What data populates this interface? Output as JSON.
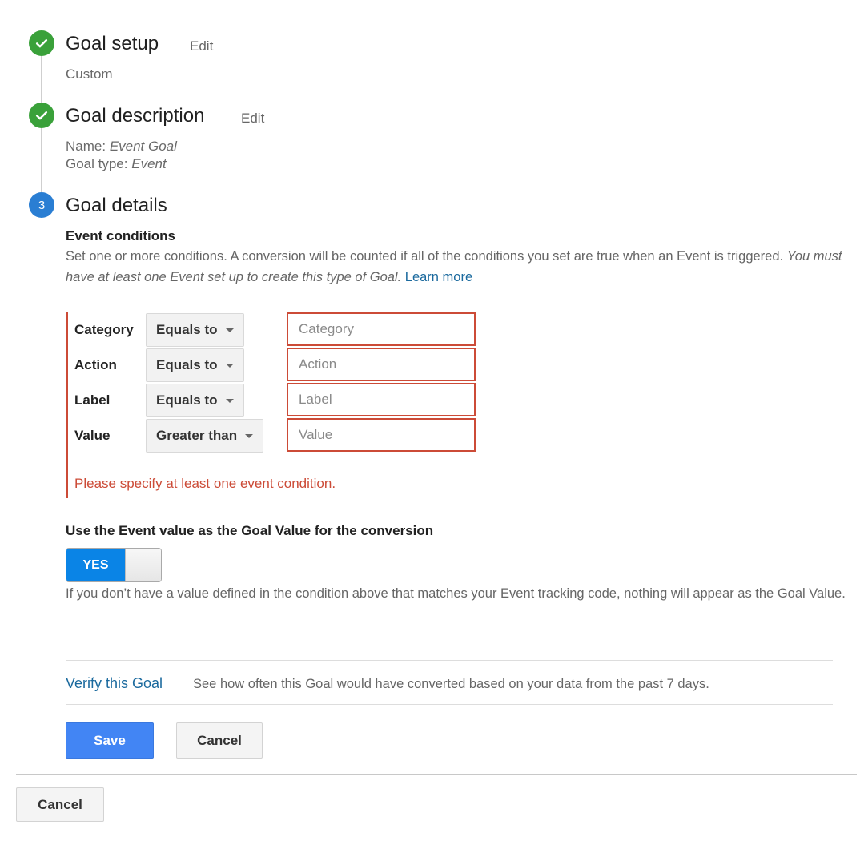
{
  "steps": [
    {
      "status": "done",
      "icon": "check-icon",
      "title": "Goal setup",
      "edit_label": "Edit",
      "summary": "Custom"
    },
    {
      "status": "done",
      "icon": "check-icon",
      "title": "Goal description",
      "edit_label": "Edit",
      "name_label": "Name:",
      "name_value": "Event Goal",
      "type_label": "Goal type:",
      "type_value": "Event"
    },
    {
      "status": "active",
      "number": "3",
      "title": "Goal details"
    }
  ],
  "event_conditions": {
    "title": "Event conditions",
    "description_plain": "Set one or more conditions. A conversion will be counted if all of the conditions you set are true when an Event is triggered.",
    "description_italic": "You must have at least one Event set up to create this type of Goal.",
    "learn_more": "Learn more",
    "rows": [
      {
        "label": "Category",
        "operator": "Equals to",
        "placeholder": "Category",
        "value": ""
      },
      {
        "label": "Action",
        "operator": "Equals to",
        "placeholder": "Action",
        "value": ""
      },
      {
        "label": "Label",
        "operator": "Equals to",
        "placeholder": "Label",
        "value": ""
      },
      {
        "label": "Value",
        "operator": "Greater than",
        "placeholder": "Value",
        "value": ""
      }
    ],
    "error": "Please specify at least one event condition.",
    "error_color": "#cc4b37"
  },
  "goal_value": {
    "title": "Use the Event value as the Goal Value for the conversion",
    "toggle_label": "YES",
    "toggle_on": true,
    "help": "If you don’t have a value defined in the condition above that matches your Event tracking code, nothing will appear as the Goal Value."
  },
  "verify": {
    "link": "Verify this Goal",
    "description": "See how often this Goal would have converted based on your data from the past 7 days."
  },
  "actions": {
    "save": "Save",
    "cancel": "Cancel"
  },
  "footer": {
    "cancel": "Cancel"
  },
  "colors": {
    "done": "#3aa13a",
    "active": "#2a7ed3",
    "link": "#1b6a9e",
    "primary": "#4285f4",
    "toggle_on": "#0a84e6"
  }
}
